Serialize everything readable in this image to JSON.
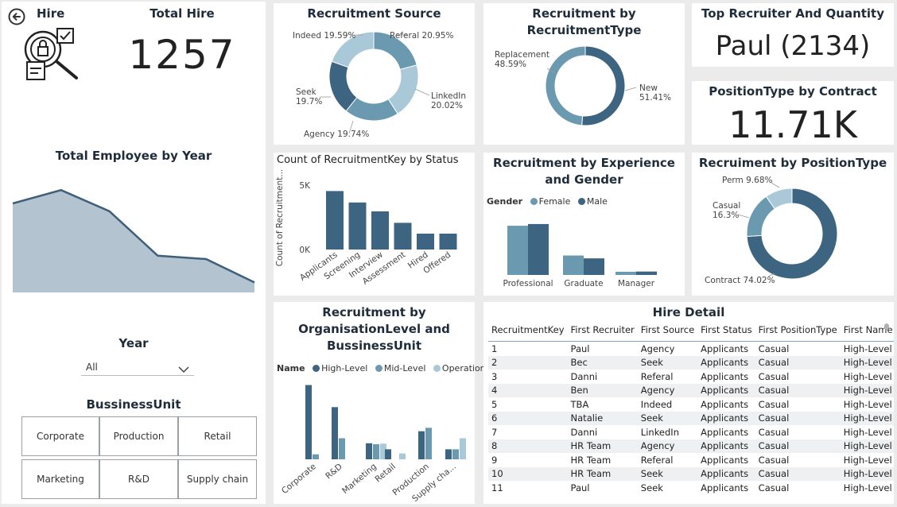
{
  "colors": {
    "dark": "#3d6480",
    "mid": "#6b9ab0",
    "light": "#a9c8d8",
    "area": "#b3c3cf",
    "line": "#3e5f7a"
  },
  "hire": {
    "label": "Hire",
    "total_title": "Total Hire",
    "total_value": "1257"
  },
  "employee_by_year": {
    "title": "Total Employee by Year"
  },
  "year_filter": {
    "label": "Year",
    "value": "All"
  },
  "business_unit": {
    "title": "BussinessUnit",
    "options": [
      "Corporate",
      "Production",
      "Retail",
      "Marketing",
      "R&D",
      "Supply chain"
    ]
  },
  "cards": {
    "source_title": "Recruitment Source",
    "type_title": "Recruitment by RecruitmentType",
    "top_recruiter_title": "Top Recruiter And Quantity",
    "top_recruiter_value": "Paul (2134)",
    "contract_title": "PositionType by Contract",
    "contract_value": "11.71K",
    "status_title": "Count of RecruitmentKey by Status",
    "status_ylabel": "Count of Recruitment...",
    "exp_title": "Recruitment by Experience and Gender",
    "exp_legend_title": "Gender",
    "ptype_title": "Recruiment by PositionType",
    "org_title": "Recruitment by OrganisationLevel and BussinessUnit",
    "org_legend_title": "Name",
    "hire_detail_title": "Hire Detail"
  },
  "hire_detail": {
    "columns": [
      "RecruitmentKey",
      "First Recruiter",
      "First Source",
      "First Status",
      "First PositionType",
      "First Name"
    ],
    "rows": [
      [
        "1",
        "Paul",
        "Agency",
        "Applicants",
        "Casual",
        "High-Level"
      ],
      [
        "2",
        "Bec",
        "Seek",
        "Applicants",
        "Casual",
        "High-Level"
      ],
      [
        "3",
        "Danni",
        "Referal",
        "Applicants",
        "Casual",
        "High-Level"
      ],
      [
        "4",
        "Ben",
        "Agency",
        "Applicants",
        "Casual",
        "High-Level"
      ],
      [
        "5",
        "TBA",
        "Indeed",
        "Applicants",
        "Casual",
        "High-Level"
      ],
      [
        "6",
        "Natalie",
        "Seek",
        "Applicants",
        "Casual",
        "High-Level"
      ],
      [
        "7",
        "Danni",
        "LinkedIn",
        "Applicants",
        "Casual",
        "High-Level"
      ],
      [
        "8",
        "HR Team",
        "Agency",
        "Applicants",
        "Casual",
        "High-Level"
      ],
      [
        "9",
        "HR Team",
        "Referal",
        "Applicants",
        "Casual",
        "High-Level"
      ],
      [
        "10",
        "HR Team",
        "Seek",
        "Applicants",
        "Casual",
        "High-Level"
      ],
      [
        "11",
        "Paul",
        "Seek",
        "Applicants",
        "Casual",
        "High-Level"
      ]
    ]
  },
  "chart_data": [
    {
      "type": "area",
      "title": "Total Employee by Year",
      "values": [
        0.8,
        0.92,
        0.73,
        0.33,
        0.3,
        0.09
      ]
    },
    {
      "type": "pie",
      "title": "Recruitment Source",
      "slices": [
        {
          "name": "Referal",
          "label": "Referal 20.95%",
          "value": 20.95,
          "color": "#6b9ab0"
        },
        {
          "name": "LinkedIn",
          "label": "LinkedIn 20.02%",
          "value": 20.02,
          "color": "#a9c8d8"
        },
        {
          "name": "Agency",
          "label": "Agency 19.74%",
          "value": 19.74,
          "color": "#6b9ab0"
        },
        {
          "name": "Seek",
          "label": "Seek 19.7%",
          "value": 19.7,
          "color": "#3d6480"
        },
        {
          "name": "Indeed",
          "label": "Indeed 19.59%",
          "value": 19.59,
          "color": "#a9c8d8"
        }
      ]
    },
    {
      "type": "pie",
      "title": "Recruitment by RecruitmentType",
      "slices": [
        {
          "name": "New",
          "label": "New 51.41%",
          "value": 51.41,
          "color": "#3d6480"
        },
        {
          "name": "Replacement",
          "label": "Replacement 48.59%",
          "value": 48.59,
          "color": "#6b9ab0"
        }
      ]
    },
    {
      "type": "bar",
      "title": "Count of RecruitmentKey by Status",
      "categories": [
        "Applicants",
        "Screening",
        "Interview",
        "Assessment",
        "Hired",
        "Offered"
      ],
      "values": [
        4600,
        3700,
        3000,
        2100,
        1250,
        1250
      ],
      "ylim": [
        0,
        6000
      ],
      "yticks": [
        "0K",
        "5K"
      ]
    },
    {
      "type": "bar",
      "title": "Recruitment by Experience and Gender",
      "categories": [
        "Professional",
        "Graduate",
        "Manager"
      ],
      "series": [
        {
          "name": "Female",
          "values": [
            4300,
            1700,
            280
          ],
          "color": "#6b9ab0"
        },
        {
          "name": "Male",
          "values": [
            4450,
            1450,
            300
          ],
          "color": "#3d6480"
        }
      ],
      "ylim": [
        0,
        5000
      ]
    },
    {
      "type": "pie",
      "title": "Recruiment by PositionType",
      "slices": [
        {
          "name": "Contract",
          "label": "Contract 74.02%",
          "value": 74.02,
          "color": "#3d6480"
        },
        {
          "name": "Casual",
          "label": "Casual 16.3%",
          "value": 16.3,
          "color": "#6b9ab0"
        },
        {
          "name": "Perm",
          "label": "Perm 9.68%",
          "value": 9.68,
          "color": "#a9c8d8"
        }
      ]
    },
    {
      "type": "bar",
      "title": "Recruitment by OrganisationLevel and BussinessUnit",
      "categories": [
        "Corporate",
        "R&D",
        "Marketing",
        "Retail",
        "Production",
        "Supply cha..."
      ],
      "series": [
        {
          "name": "High-Level",
          "values": [
            3700,
            2600,
            800,
            500,
            1400,
            500
          ],
          "color": "#3d6480"
        },
        {
          "name": "Mid-Level",
          "values": [
            250,
            1050,
            750,
            0,
            1570,
            500
          ],
          "color": "#6b9ab0"
        },
        {
          "name": "Operational",
          "values": [
            0,
            0,
            780,
            290,
            0,
            1050
          ],
          "color": "#a9c8d8"
        }
      ],
      "ylim": [
        0,
        4000
      ]
    }
  ]
}
